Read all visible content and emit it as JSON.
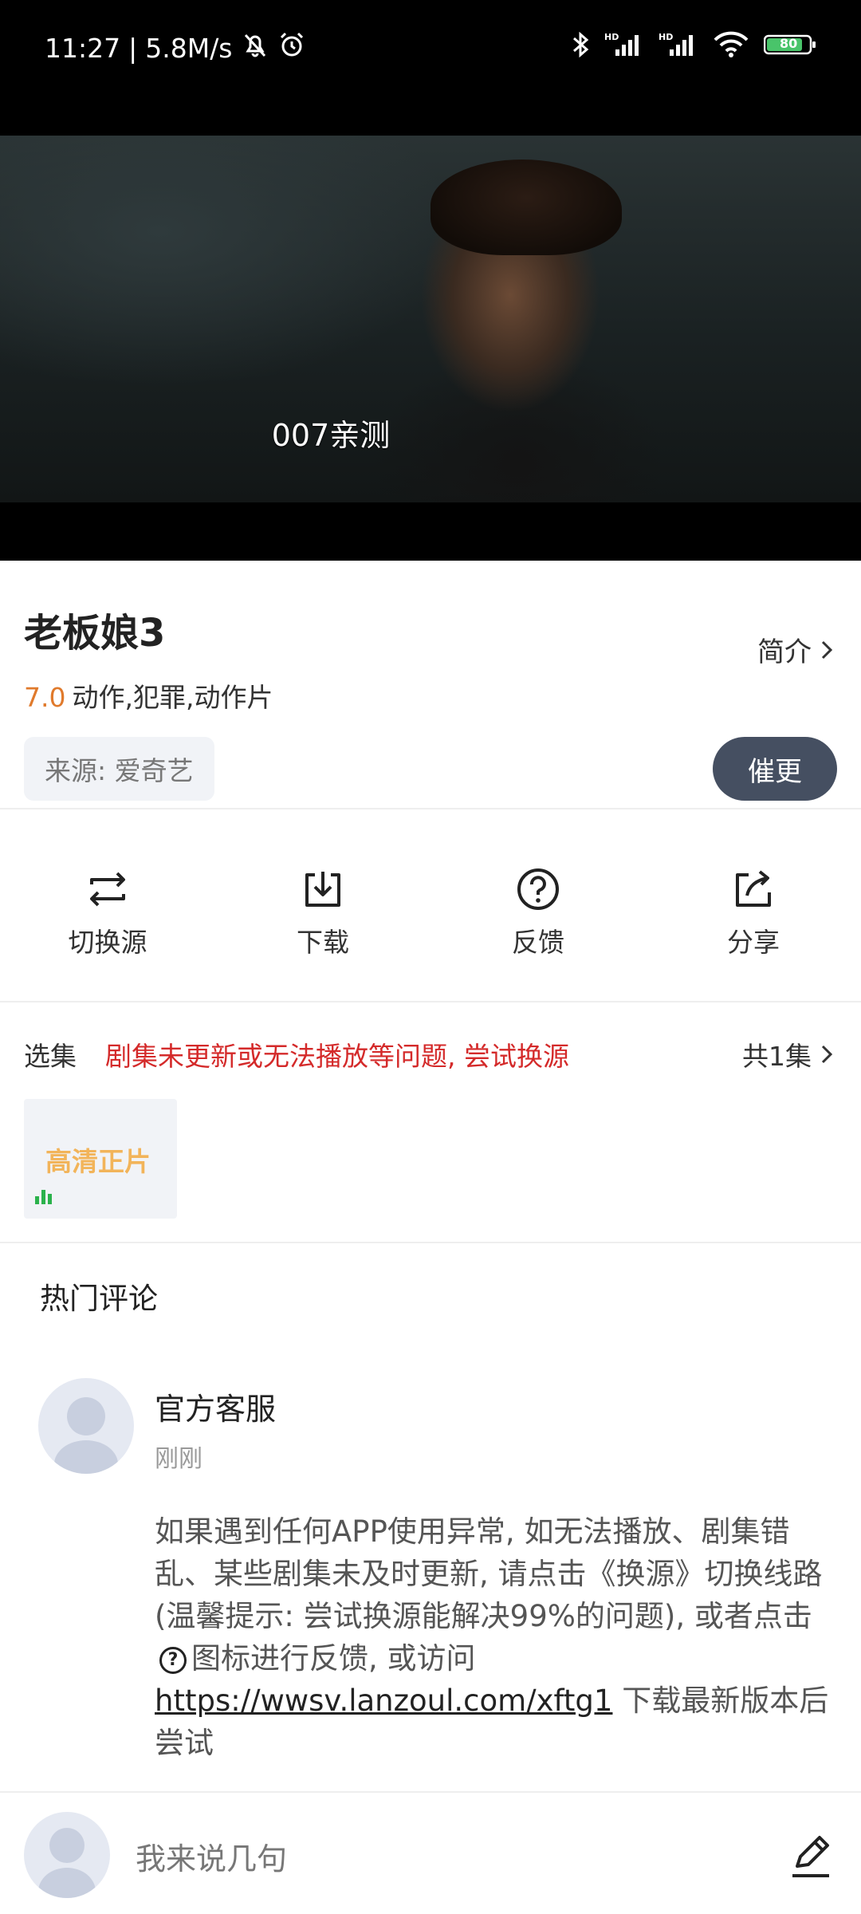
{
  "status_bar": {
    "time": "11:27",
    "separator": "|",
    "net_speed": "5.8M/s",
    "battery": "80",
    "icons": [
      "mute-bell-icon",
      "alarm-icon",
      "bluetooth-icon",
      "hd-signal-icon",
      "hd-signal-icon",
      "wifi-icon",
      "battery-icon"
    ]
  },
  "video": {
    "subtitle": "007亲测"
  },
  "info": {
    "title": "老板娘3",
    "intro_label": "简介",
    "score": "7.0",
    "genres": "动作,犯罪,动作片",
    "source": "来源: 爱奇艺",
    "urge_label": "催更"
  },
  "actions": [
    {
      "label": "切换源",
      "icon": "switch-source-icon"
    },
    {
      "label": "下载",
      "icon": "download-icon"
    },
    {
      "label": "反馈",
      "icon": "question-icon"
    },
    {
      "label": "分享",
      "icon": "share-icon"
    }
  ],
  "episodes": {
    "label": "选集",
    "hint": "剧集未更新或无法播放等问题, 尝试换源",
    "count": "共1集",
    "items": [
      {
        "label": "高清正片"
      }
    ]
  },
  "comments": {
    "title": "热门评论",
    "items": [
      {
        "name": "官方客服",
        "time": "刚刚",
        "text_before": "如果遇到任何APP使用异常, 如无法播放、剧集错乱、某些剧集未及时更新, 请点击《换源》切换线路(温馨提示: 尝试换源能解决99%的问题), 或者点击",
        "text_middle": "图标进行反馈, 或访问",
        "link": "https://wwsv.lanzoul.com/xftg1",
        "text_after": "下载最新版本后尝试"
      }
    ]
  },
  "input_bar": {
    "placeholder": "我来说几句"
  }
}
